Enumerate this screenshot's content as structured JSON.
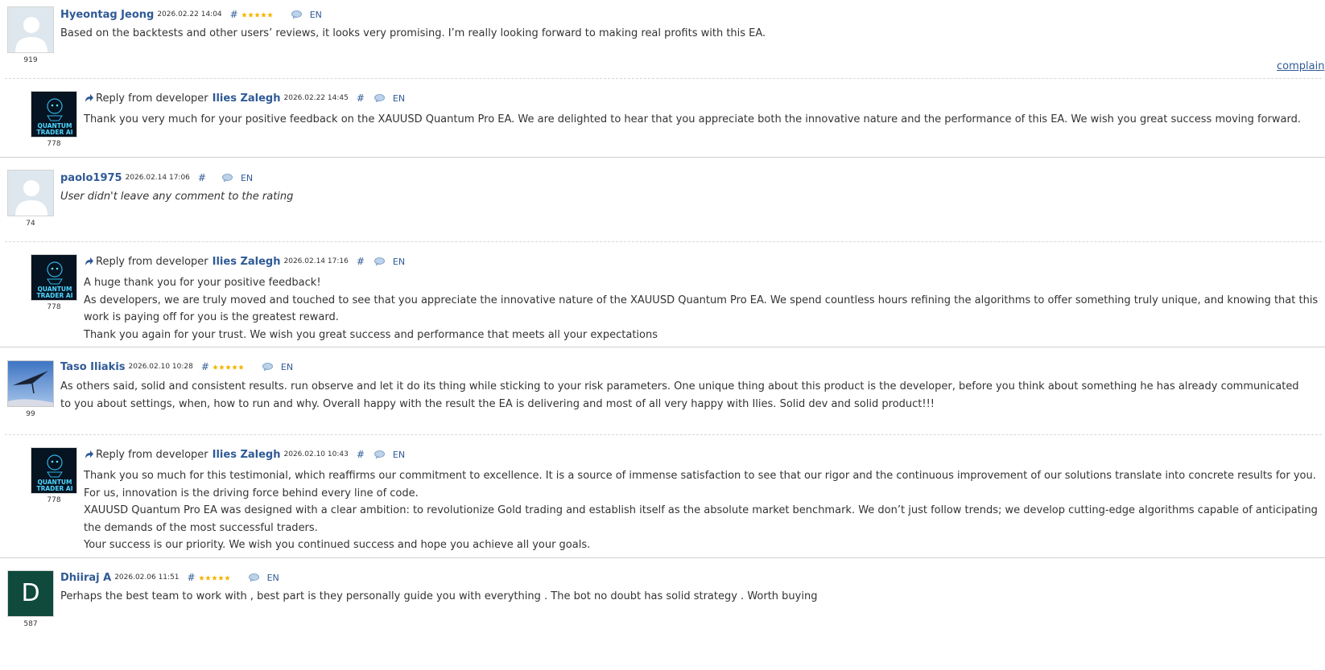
{
  "colors": {
    "link": "#2f5a96",
    "star": "#f5b400",
    "text": "#333333"
  },
  "labels": {
    "reply_prefix": "Reply from developer",
    "hash": "#",
    "complain": "complain"
  },
  "reviews": [
    {
      "author": "Hyeontag Jeong",
      "date": "2026.02.22 14:04",
      "stars": 5,
      "lang": "EN",
      "rating_num": "919",
      "avatar": "default-user",
      "text": [
        "Based on the backtests and other users’ reviews, it looks very promising. I’m really looking forward to making real profits with this EA."
      ],
      "reply": {
        "author": "Ilies Zalegh",
        "date": "2026.02.22 14:45",
        "lang": "EN",
        "rating_num": "778",
        "text": [
          "Thank you very much for your positive feedback on the XAUUSD Quantum Pro EA. We are delighted to hear that you appreciate both the innovative nature and the performance of this EA. We wish you great success moving forward."
        ]
      }
    },
    {
      "author": "paolo1975",
      "date": "2026.02.14 17:06",
      "stars": 0,
      "lang": "EN",
      "rating_num": "74",
      "avatar": "default-user",
      "text": [
        "User didn't leave any comment to the rating"
      ],
      "reply": {
        "author": "Ilies Zalegh",
        "date": "2026.02.14 17:16",
        "lang": "EN",
        "rating_num": "778",
        "text": [
          "A huge thank you for your positive feedback!",
          "As developers, we are truly moved and touched to see that you appreciate the innovative nature of the XAUUSD Quantum Pro EA. We spend countless hours refining the algorithms to offer something truly unique, and knowing that this work is paying off for you is the greatest reward.",
          "Thank you again for your trust. We wish you great success and performance that meets all your expectations"
        ]
      }
    },
    {
      "author": "Taso Iliakis",
      "date": "2026.02.10 10:28",
      "stars": 5,
      "lang": "EN",
      "rating_num": "99",
      "avatar": "hang-glider-photo",
      "text": [
        "As others said, solid and consistent results. run observe and let it do its thing while sticking to your risk parameters. One unique thing about this product is the developer, before you think about something he has already communicated to you about settings, when, how to run and why. Overall happy with the result the EA is delivering and most of all very happy with Ilies. Solid dev and solid product!!!"
      ],
      "reply": {
        "author": "Ilies Zalegh",
        "date": "2026.02.10 10:43",
        "lang": "EN",
        "rating_num": "778",
        "text": [
          "Thank you so much for this testimonial, which reaffirms our commitment to excellence. It is a source of immense satisfaction to see that our rigor and the continuous improvement of our solutions translate into concrete results for you. For us, innovation is the driving force behind every line of code.",
          "XAUUSD Quantum Pro EA was designed with a clear ambition: to revolutionize Gold trading and establish itself as the absolute market benchmark. We don’t just follow trends; we develop cutting-edge algorithms capable of anticipating the demands of the most successful traders.",
          "Your success is our priority. We wish you continued success and hope you achieve all your goals."
        ]
      }
    },
    {
      "author": "Dhiiraj A",
      "date": "2026.02.06 11:51",
      "stars": 5,
      "lang": "EN",
      "rating_num": "587",
      "avatar": "letter-avatar",
      "avatar_letter": "D",
      "text": [
        "Perhaps the best team to work with , best part is they personally guide you with everything . The bot no doubt has solid strategy . Worth buying"
      ]
    }
  ],
  "dev_avatar_text": [
    "QUANTUM",
    "TRADER AI"
  ]
}
